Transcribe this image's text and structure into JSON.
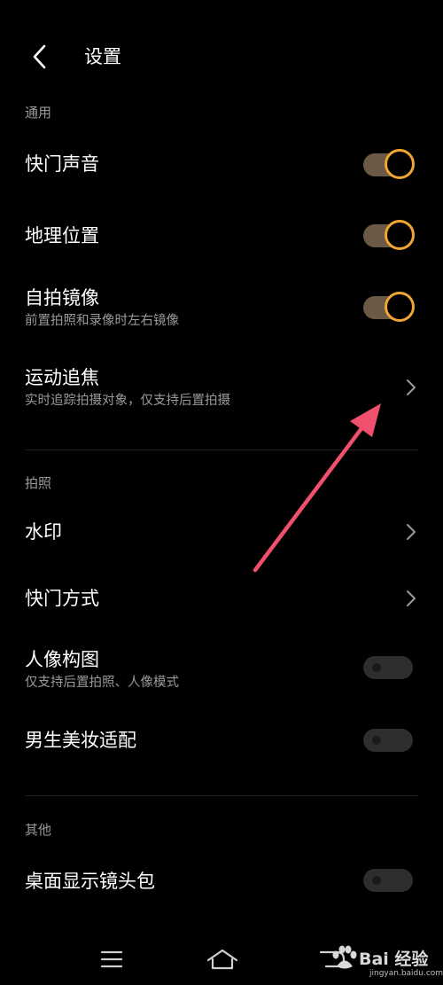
{
  "header": {
    "title": "设置"
  },
  "sections": {
    "general": {
      "label": "通用",
      "shutter_sound": {
        "title": "快门声音",
        "on": true
      },
      "location": {
        "title": "地理位置",
        "on": true
      },
      "mirror_selfie": {
        "title": "自拍镜像",
        "subtitle": "前置拍照和录像时左右镜像",
        "on": true
      },
      "motion_focus": {
        "title": "运动追焦",
        "subtitle": "实时追踪拍摄对象，仅支持后置拍摄"
      }
    },
    "photo": {
      "label": "拍照",
      "watermark": {
        "title": "水印"
      },
      "shutter_mode": {
        "title": "快门方式"
      },
      "portrait_composition": {
        "title": "人像构图",
        "subtitle": "仅支持后置拍照、人像模式",
        "on": false
      },
      "male_makeup": {
        "title": "男生美妆适配",
        "on": false
      }
    },
    "other": {
      "label": "其他",
      "desktop_lens_pack": {
        "title": "桌面显示镜头包",
        "on": false
      }
    }
  },
  "watermark_brand": {
    "text": "Bai 经验",
    "url": "jingyan.baidu.com"
  },
  "colors": {
    "accent": "#f0a630",
    "arrow": "#f0506e",
    "toggle_on_track": "#6a5a45",
    "toggle_off_track": "#2e2e2e",
    "secondary_text": "#9a9a9a"
  },
  "icons": {
    "back": "chevron-left-icon",
    "row_next": "chevron-right-icon",
    "nav_menu": "menu-icon",
    "nav_home": "home-icon",
    "nav_back": "back-icon"
  }
}
